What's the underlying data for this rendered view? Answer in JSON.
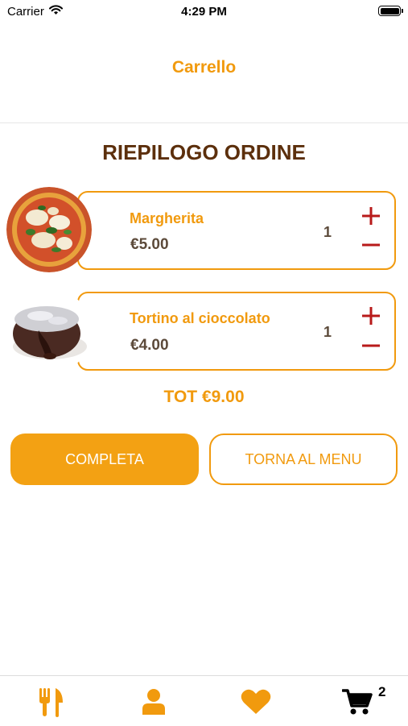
{
  "status_bar": {
    "carrier": "Carrier",
    "time": "4:29 PM"
  },
  "nav": {
    "title": "Carrello"
  },
  "summary": {
    "title": "RIEPILOGO ORDINE"
  },
  "cart_items": [
    {
      "name": "Margherita",
      "price": "€5.00",
      "quantity": "1",
      "image": "pizza-margherita"
    },
    {
      "name": "Tortino al cioccolato",
      "price": "€4.00",
      "quantity": "1",
      "image": "chocolate-lava-cake"
    }
  ],
  "total": {
    "label": "TOT €9.00"
  },
  "actions": {
    "complete_label": "COMPLETA",
    "back_label": "TORNA AL MENU"
  },
  "tab_bar": {
    "tabs": [
      {
        "icon": "fork-knife-icon"
      },
      {
        "icon": "user-icon"
      },
      {
        "icon": "heart-icon"
      },
      {
        "icon": "cart-icon"
      }
    ],
    "cart_badge": "2"
  },
  "colors": {
    "accent": "#f19a0e",
    "primary_button": "#f3a113",
    "heading": "#5c2f0c",
    "price_text": "#5c4a3a",
    "stepper": "#b81a1a"
  }
}
